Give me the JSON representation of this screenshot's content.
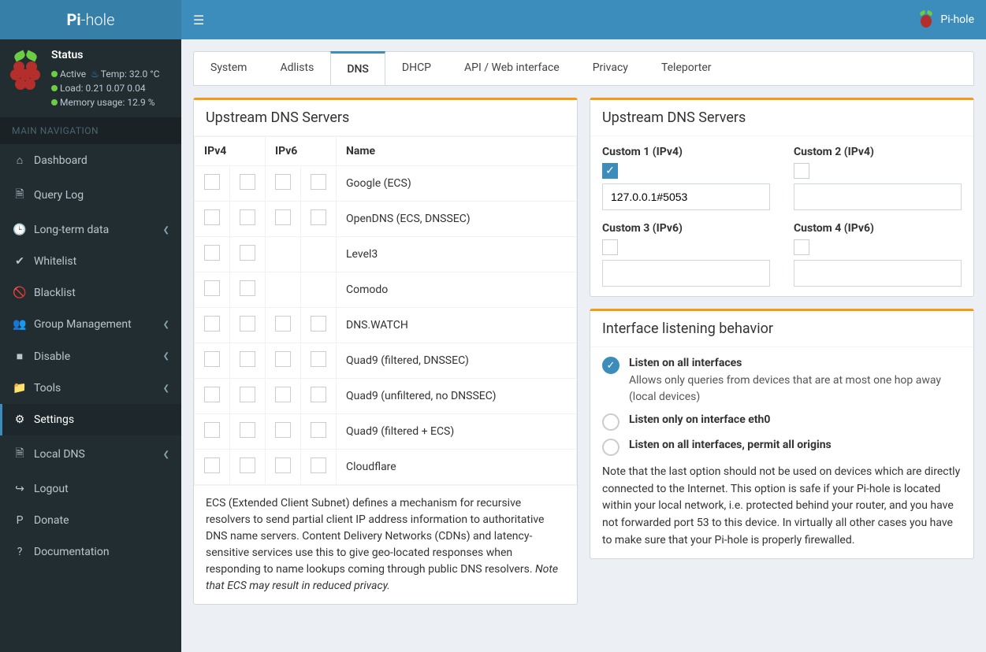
{
  "brand": {
    "part1": "Pi",
    "dash": "-",
    "part2": "hole",
    "full": "Pi-hole"
  },
  "status": {
    "title": "Status",
    "active": "Active",
    "temp_label": "Temp:",
    "temp_value": "32.0 °C",
    "load_label": "Load:",
    "load_value": "0.21 0.07 0.04",
    "mem_label": "Memory usage:",
    "mem_value": "12.9 %"
  },
  "nav_header": "MAIN NAVIGATION",
  "nav": [
    {
      "icon": "⌂",
      "label": "Dashboard",
      "chevron": false
    },
    {
      "icon": "🗎",
      "label": "Query Log",
      "chevron": false
    },
    {
      "icon": "🕒",
      "label": "Long-term data",
      "chevron": true
    },
    {
      "icon": "✔",
      "label": "Whitelist",
      "chevron": false
    },
    {
      "icon": "🚫",
      "label": "Blacklist",
      "chevron": false
    },
    {
      "icon": "👥",
      "label": "Group Management",
      "chevron": true
    },
    {
      "icon": "■",
      "label": "Disable",
      "chevron": true
    },
    {
      "icon": "📁",
      "label": "Tools",
      "chevron": true
    },
    {
      "icon": "⚙",
      "label": "Settings",
      "chevron": false,
      "active": true
    },
    {
      "icon": "🗎",
      "label": "Local DNS",
      "chevron": true
    },
    {
      "icon": "↪",
      "label": "Logout",
      "chevron": false
    },
    {
      "icon": "P",
      "label": "Donate",
      "chevron": false
    },
    {
      "icon": "?",
      "label": "Documentation",
      "chevron": false
    }
  ],
  "tabs": [
    "System",
    "Adlists",
    "DNS",
    "DHCP",
    "API / Web interface",
    "Privacy",
    "Teleporter"
  ],
  "active_tab": "DNS",
  "upstream": {
    "title": "Upstream DNS Servers",
    "headers": {
      "ipv4": "IPv4",
      "ipv6": "IPv6",
      "name": "Name"
    },
    "rows": [
      {
        "name": "Google (ECS)",
        "ipv4": 2,
        "ipv6": 2
      },
      {
        "name": "OpenDNS (ECS, DNSSEC)",
        "ipv4": 2,
        "ipv6": 2
      },
      {
        "name": "Level3",
        "ipv4": 2,
        "ipv6": 0
      },
      {
        "name": "Comodo",
        "ipv4": 2,
        "ipv6": 0
      },
      {
        "name": "DNS.WATCH",
        "ipv4": 2,
        "ipv6": 2
      },
      {
        "name": "Quad9 (filtered, DNSSEC)",
        "ipv4": 2,
        "ipv6": 2
      },
      {
        "name": "Quad9 (unfiltered, no DNSSEC)",
        "ipv4": 2,
        "ipv6": 2
      },
      {
        "name": "Quad9 (filtered + ECS)",
        "ipv4": 2,
        "ipv6": 2
      },
      {
        "name": "Cloudflare",
        "ipv4": 2,
        "ipv6": 2
      }
    ],
    "footer_text": "ECS (Extended Client Subnet) defines a mechanism for recursive resolvers to send partial client IP address information to authoritative DNS name servers. Content Delivery Networks (CDNs) and latency-sensitive services use this to give geo-located responses when responding to name lookups coming through public DNS resolvers. ",
    "footer_em": "Note that ECS may result in reduced privacy."
  },
  "custom": {
    "title": "Upstream DNS Servers",
    "fields": {
      "c1": {
        "label": "Custom 1 (IPv4)",
        "checked": true,
        "value": "127.0.0.1#5053"
      },
      "c2": {
        "label": "Custom 2 (IPv4)",
        "checked": false,
        "value": ""
      },
      "c3": {
        "label": "Custom 3 (IPv6)",
        "checked": false,
        "value": ""
      },
      "c4": {
        "label": "Custom 4 (IPv6)",
        "checked": false,
        "value": ""
      }
    }
  },
  "iface": {
    "title": "Interface listening behavior",
    "options": [
      {
        "label": "Listen on all interfaces",
        "selected": true,
        "desc": "Allows only queries from devices that are at most one hop away (local devices)"
      },
      {
        "label": "Listen only on interface eth0",
        "selected": false
      },
      {
        "label": "Listen on all interfaces, permit all origins",
        "selected": false
      }
    ],
    "note": "Note that the last option should not be used on devices which are directly connected to the Internet. This option is safe if your Pi-hole is located within your local network, i.e. protected behind your router, and you have not forwarded port 53 to this device. In virtually all other cases you have to make sure that your Pi-hole is properly firewalled."
  }
}
